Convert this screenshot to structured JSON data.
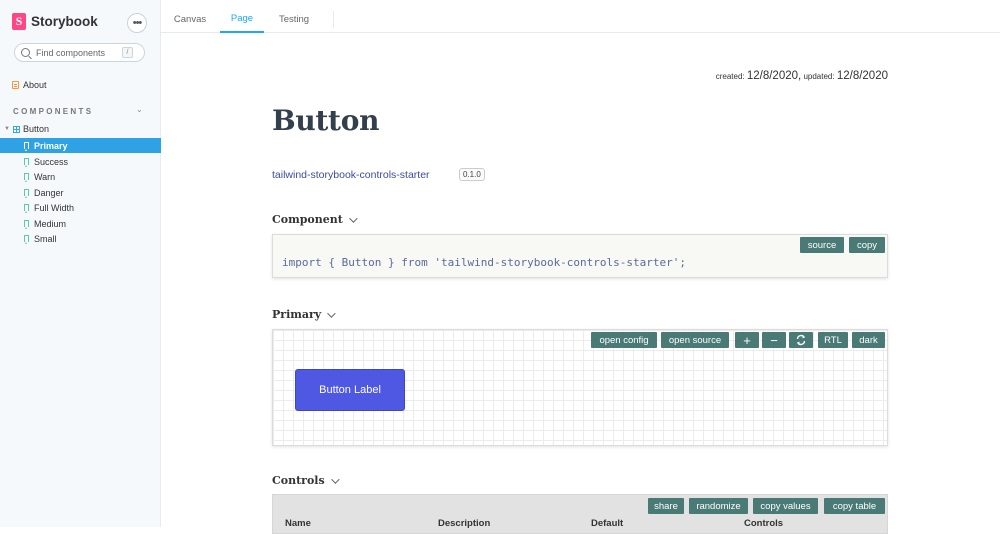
{
  "sidebar": {
    "brand": "Storybook",
    "menu_icon": "ellipsis-icon",
    "search": {
      "placeholder": "Find components",
      "shortcut": "/"
    },
    "about": "About",
    "section_heading": "COMPONENTS",
    "component": "Button",
    "stories": [
      "Primary",
      "Success",
      "Warn",
      "Danger",
      "Full Width",
      "Medium",
      "Small"
    ],
    "active_story": "Primary"
  },
  "tabs": [
    "Canvas",
    "Page",
    "Testing"
  ],
  "active_tab": "Page",
  "meta": {
    "created_label": "created:",
    "created": "12/8/2020",
    "separator": ",",
    "updated_label": "updated:",
    "updated": "12/8/2020"
  },
  "page": {
    "title": "Button",
    "package": "tailwind-storybook-controls-starter",
    "version": "0.1.0"
  },
  "component_section": {
    "heading": "Component",
    "buttons": {
      "source": "source",
      "copy": "copy"
    },
    "code": {
      "kw1": "import",
      "mid": " { Button } ",
      "kw2": "from",
      "str": " 'tailwind-storybook-controls-starter'",
      "end": ";"
    }
  },
  "primary_section": {
    "heading": "Primary",
    "buttons": {
      "open_config": "open config",
      "open_source": "open source",
      "zoom_in": "+",
      "zoom_out": "−",
      "rtl": "RTL",
      "dark": "dark"
    },
    "demo_button": "Button Label"
  },
  "controls_section": {
    "heading": "Controls",
    "buttons": {
      "share": "share",
      "randomize": "randomize",
      "copy_values": "copy values",
      "copy_table": "copy table"
    },
    "columns": [
      "Name",
      "Description",
      "Default",
      "Controls"
    ]
  },
  "colors": {
    "accent": "#1ea7fd",
    "toolbar_button": "#4a7a76",
    "demo_button": "#4f58e3",
    "selected_story": "#2fa2e6"
  }
}
